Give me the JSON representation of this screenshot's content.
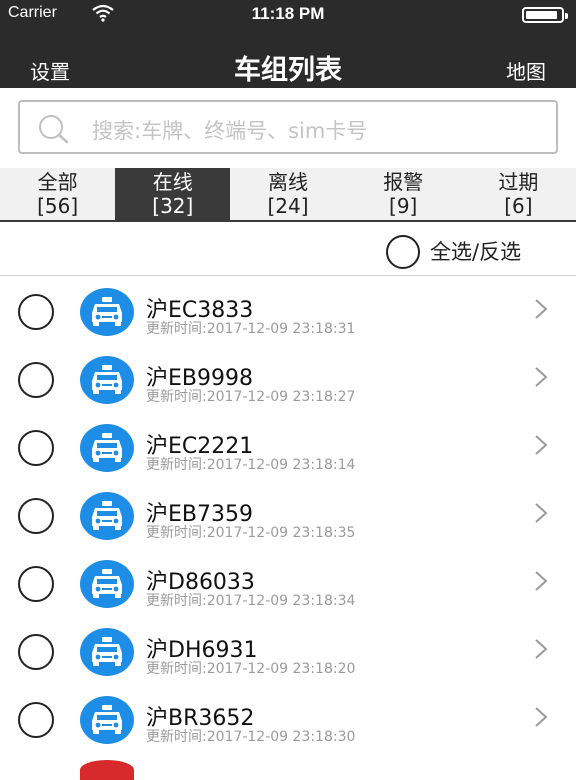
{
  "status_bar": {
    "carrier": "Carrier",
    "time": "11:18 PM",
    "battery_level": 0.9
  },
  "nav": {
    "left": "设置",
    "title": "车组列表",
    "right": "地图"
  },
  "search": {
    "placeholder": "搜索:车牌、终端号、sim卡号"
  },
  "tabs": [
    {
      "label": "全部",
      "count": "[56]"
    },
    {
      "label": "在线",
      "count": "[32]"
    },
    {
      "label": "离线",
      "count": "[24]"
    },
    {
      "label": "报警",
      "count": "[9]"
    },
    {
      "label": "过期",
      "count": "[6]"
    }
  ],
  "active_tab": 1,
  "select_all": {
    "label": "全选/反选"
  },
  "vehicles": [
    {
      "plate": "沪EC3833",
      "updated": "更新时间:2017-12-09 23:18:31"
    },
    {
      "plate": "沪EB9998",
      "updated": "更新时间:2017-12-09 23:18:27"
    },
    {
      "plate": "沪EC2221",
      "updated": "更新时间:2017-12-09 23:18:14"
    },
    {
      "plate": "沪EB7359",
      "updated": "更新时间:2017-12-09 23:18:35"
    },
    {
      "plate": "沪D86033",
      "updated": "更新时间:2017-12-09 23:18:34"
    },
    {
      "plate": "沪DH6931",
      "updated": "更新时间:2017-12-09 23:18:20"
    },
    {
      "plate": "沪BR3652",
      "updated": "更新时间:2017-12-09 23:18:30"
    }
  ],
  "colors": {
    "nav_bg": "#2b2b2b",
    "car_icon": "#1e8de6",
    "alarm_icon": "#d72a2a",
    "active_tab": "#3a3a3a"
  }
}
